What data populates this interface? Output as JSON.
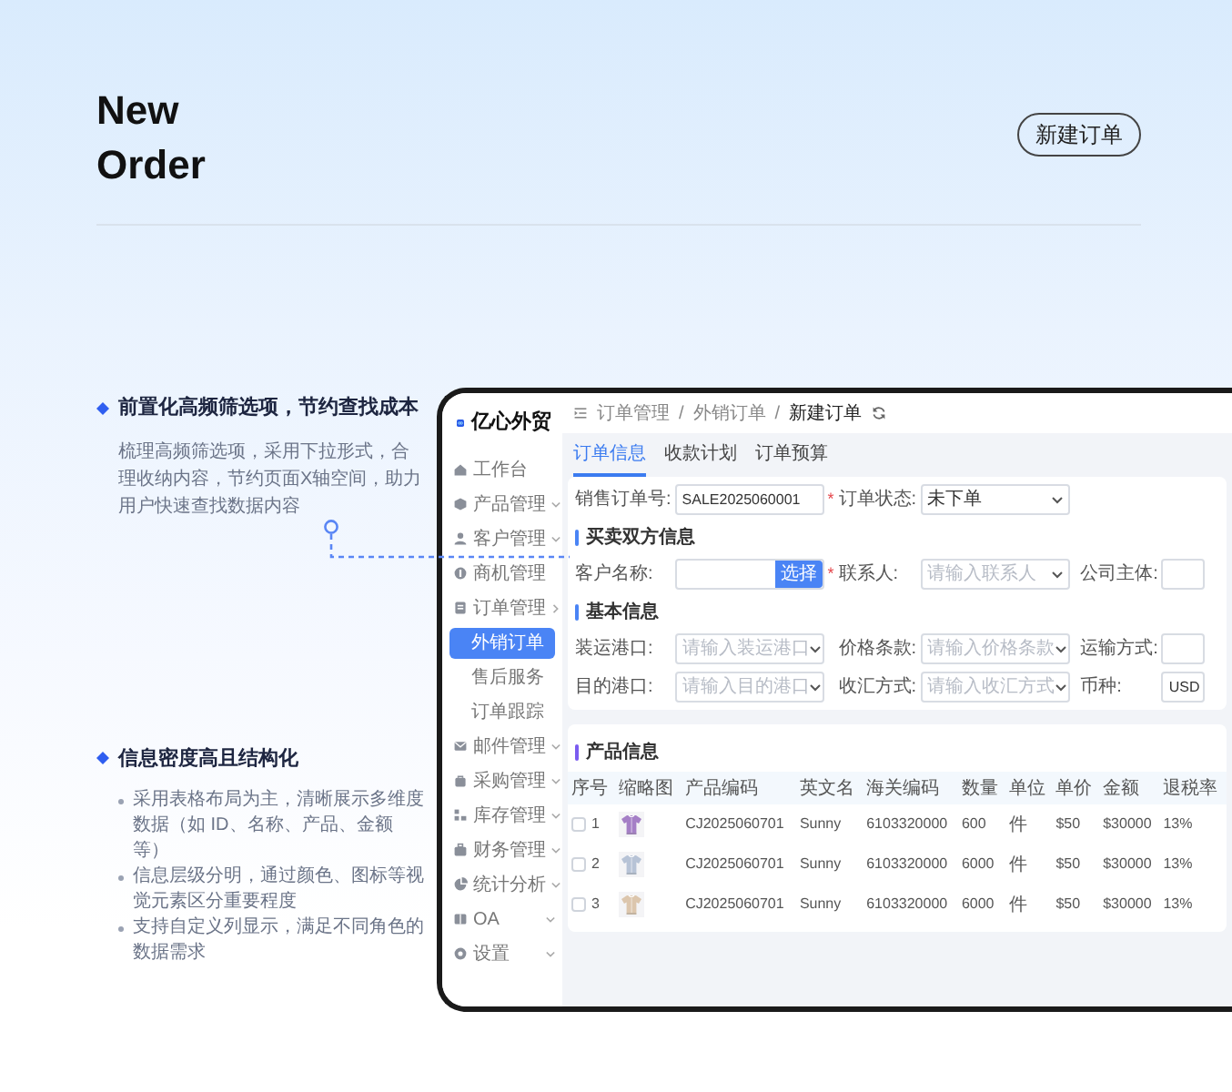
{
  "header": {
    "title": [
      "New",
      "Order"
    ],
    "tag": "新建订单"
  },
  "features": [
    {
      "heading": "前置化高频筛选项，节约查找成本",
      "kind": "paragraph",
      "text": "梳理高频筛选项，采用下拉形式，合理收纳内容，节约页面X轴空间，助力用户快速查找数据内容"
    },
    {
      "heading": "信息密度高且结构化",
      "kind": "bullets",
      "bullets": [
        "采用表格布局为主，清晰展示多维度数据（如 ID、名称、产品、金额等）",
        "信息层级分明，通过颜色、图标等视觉元素区分重要程度",
        "支持自定义列显示，满足不同角色的数据需求"
      ]
    }
  ],
  "app": {
    "logo": "亿心外贸",
    "required_mark": "*",
    "sidebar": [
      {
        "label": "工作台",
        "selected": false
      },
      {
        "label": "产品管理",
        "selected": false,
        "expanded": false
      },
      {
        "label": "客户管理",
        "selected": false,
        "expanded": false
      },
      {
        "label": "商机管理",
        "selected": false
      },
      {
        "label": "订单管理",
        "selected": false,
        "expanded": true,
        "children": [
          {
            "label": "外销订单",
            "selected": true
          },
          {
            "label": "售后服务",
            "selected": false
          },
          {
            "label": "订单跟踪",
            "selected": false
          }
        ]
      },
      {
        "label": "邮件管理",
        "selected": false,
        "expanded": false
      },
      {
        "label": "采购管理",
        "selected": false,
        "expanded": false
      },
      {
        "label": "库存管理",
        "selected": false,
        "expanded": false
      },
      {
        "label": "财务管理",
        "selected": false,
        "expanded": false
      },
      {
        "label": "统计分析",
        "selected": false,
        "expanded": false
      },
      {
        "label": "OA",
        "selected": false,
        "expanded": false
      },
      {
        "label": "设置",
        "selected": false,
        "expanded": false
      }
    ],
    "breadcrumb": {
      "items": [
        "订单管理",
        "外销订单",
        "新建订单"
      ],
      "separator": "/"
    },
    "tabs": [
      {
        "label": "订单信息",
        "selected": true
      },
      {
        "label": "收款计划",
        "selected": false
      },
      {
        "label": "订单预算",
        "selected": false
      }
    ],
    "form": [
      {
        "kind": "row",
        "fields": [
          {
            "label": "销售订单号:",
            "kind": "input",
            "value": "SALE2025060001",
            "required": true
          },
          {
            "label": "订单状态:",
            "kind": "select",
            "value": "未下单",
            "required": false
          }
        ]
      },
      {
        "kind": "section",
        "title": "买卖双方信息"
      },
      {
        "kind": "row",
        "fields": [
          {
            "label": "客户名称:",
            "kind": "picker",
            "button": "选择",
            "required": true
          },
          {
            "label": "联系人:",
            "kind": "select",
            "placeholder": "请输入联系人",
            "required": false
          },
          {
            "label": "公司主体:",
            "kind": "input",
            "required": false
          }
        ]
      },
      {
        "kind": "section",
        "title": "基本信息"
      },
      {
        "kind": "row",
        "fields": [
          {
            "label": "装运港口:",
            "kind": "select",
            "placeholder": "请输入装运港口",
            "required": false
          },
          {
            "label": "价格条款:",
            "kind": "select",
            "placeholder": "请输入价格条款",
            "required": false
          },
          {
            "label": "运输方式:",
            "kind": "input",
            "required": false
          }
        ]
      },
      {
        "kind": "row",
        "fields": [
          {
            "label": "目的港口:",
            "kind": "select",
            "placeholder": "请输入目的港口",
            "required": false
          },
          {
            "label": "收汇方式:",
            "kind": "select",
            "placeholder": "请输入收汇方式",
            "required": false
          },
          {
            "label": "币种:",
            "kind": "input",
            "value": "USD",
            "required": false
          }
        ]
      }
    ],
    "products": {
      "title": "产品信息",
      "columns": [
        "序号",
        "缩略图",
        "产品编码",
        "英文名",
        "海关编码",
        "数量",
        "单位",
        "单价",
        "金额",
        "退税率"
      ],
      "rows": [
        {
          "checked": false,
          "index": "1",
          "code": "CJ2025060701",
          "english_name": "Sunny",
          "hs_code": "6103320000",
          "quantity": "600",
          "unit": "件",
          "price": "$50",
          "amount": "$30000",
          "rebate_rate": "13%"
        },
        {
          "checked": false,
          "index": "2",
          "code": "CJ2025060701",
          "english_name": "Sunny",
          "hs_code": "6103320000",
          "quantity": "6000",
          "unit": "件",
          "price": "$50",
          "amount": "$30000",
          "rebate_rate": "13%"
        },
        {
          "checked": false,
          "index": "3",
          "code": "CJ2025060701",
          "english_name": "Sunny",
          "hs_code": "6103320000",
          "quantity": "6000",
          "unit": "件",
          "price": "$50",
          "amount": "$30000",
          "rebate_rate": "13%"
        }
      ]
    }
  }
}
